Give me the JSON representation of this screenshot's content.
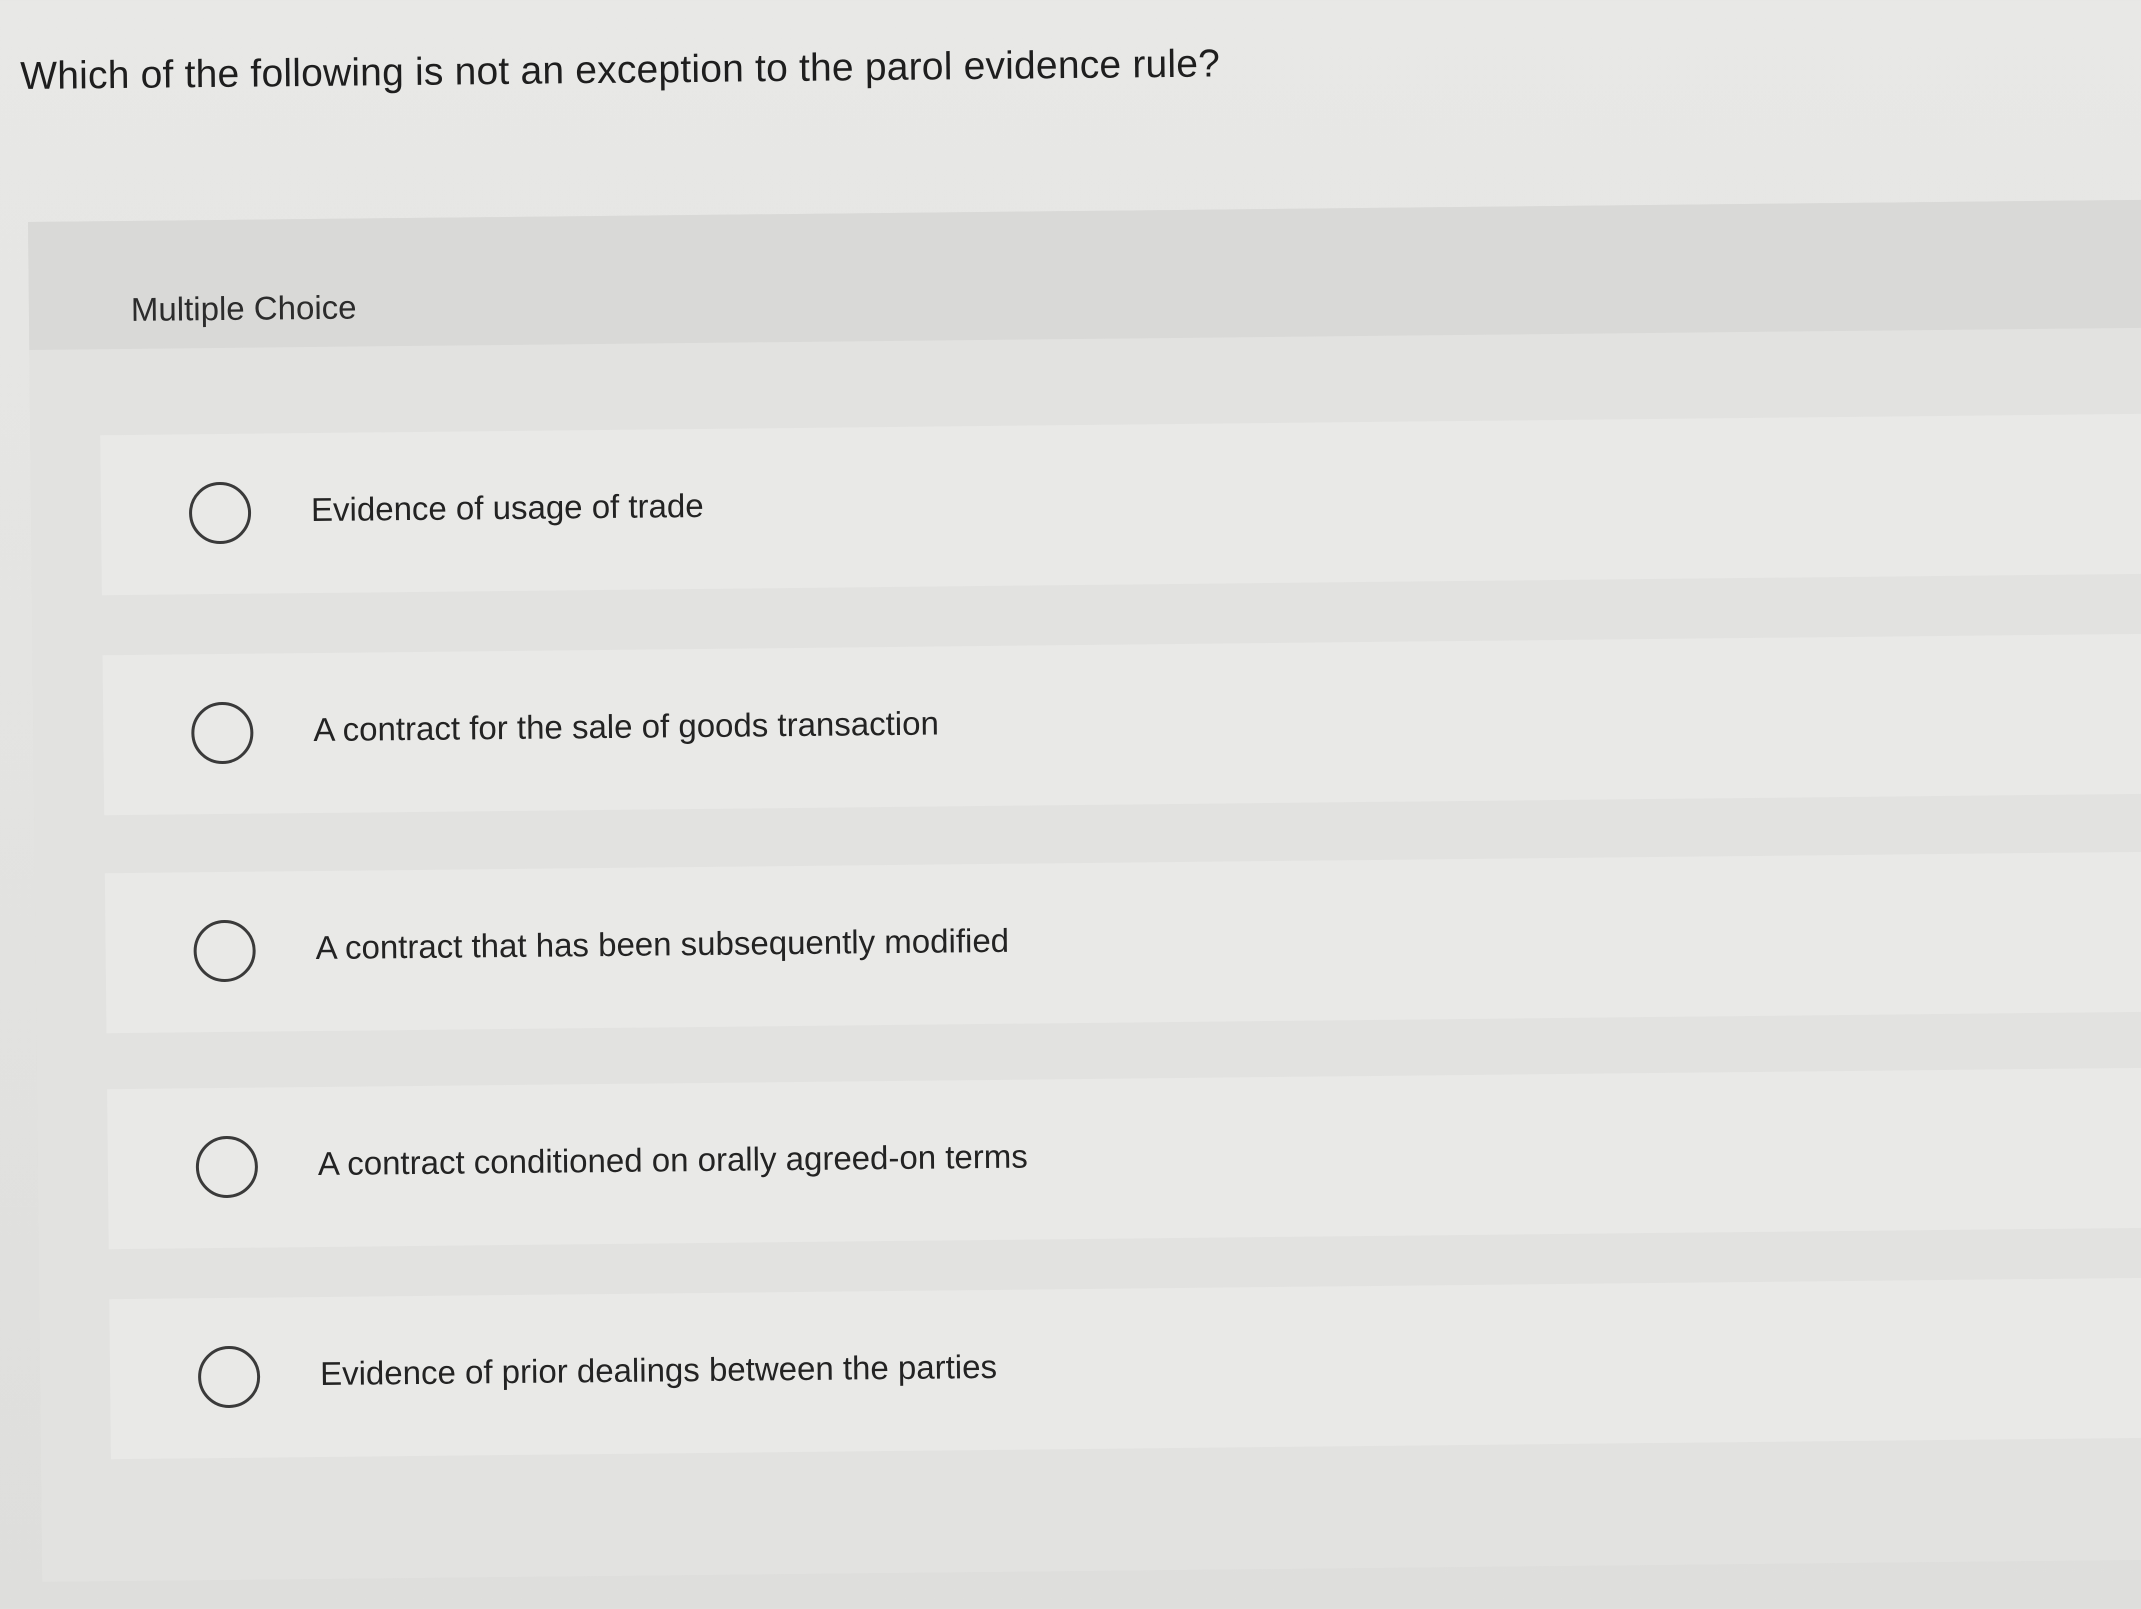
{
  "question": {
    "text": "Which of the following is not an exception to the parol evidence rule?"
  },
  "panel": {
    "title": "Multiple Choice"
  },
  "options": [
    {
      "label": "Evidence of usage of trade"
    },
    {
      "label": "A contract for the sale of goods transaction"
    },
    {
      "label": "A contract that has been subsequently modified"
    },
    {
      "label": "A contract conditioned on orally agreed-on terms"
    },
    {
      "label": "Evidence of prior dealings between the parties"
    }
  ]
}
